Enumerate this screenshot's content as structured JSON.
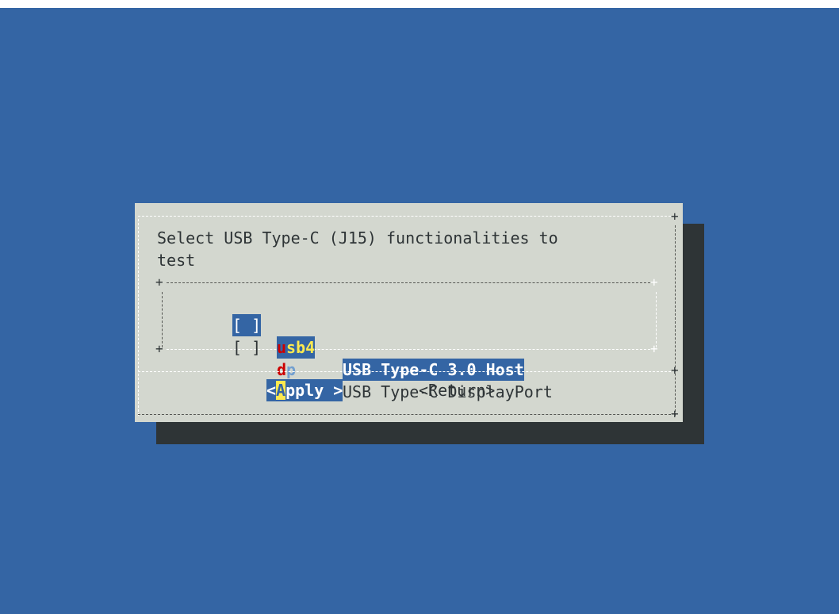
{
  "dialog": {
    "prompt": "Select USB Type-C (J15) functionalities to\ntest"
  },
  "options": [
    {
      "checkbox": "[ ]",
      "tag_first": "u",
      "tag_rest": "sb4",
      "description": "USB Type-C 3.0 Host",
      "selected": true
    },
    {
      "checkbox": "[ ]",
      "tag_first": "d",
      "tag_rest": "p",
      "description": "USB Type-C DisplayPort",
      "selected": false
    }
  ],
  "buttons": {
    "apply": {
      "open": "<",
      "hot": "A",
      "rest": "pply >"
    },
    "return": {
      "label": "<Return>"
    }
  },
  "colors": {
    "screen_background": "#3465a4",
    "dialog_background": "#d3d7cf",
    "shadow": "#2e3436",
    "selection": "#3465a4",
    "hotkey_red": "#cc0000",
    "hotkey_yellow": "#fce94f",
    "tag_rest_blue": "#729fcf"
  }
}
